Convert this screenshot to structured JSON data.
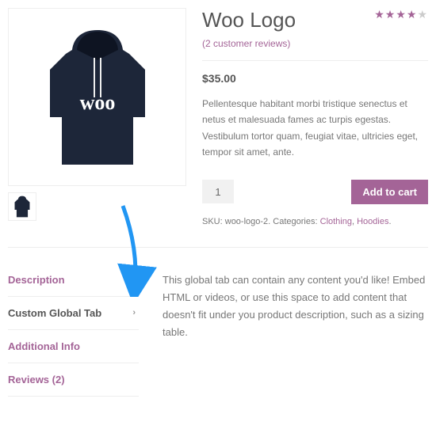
{
  "product": {
    "title": "Woo Logo",
    "reviews_link": "(2 customer reviews)",
    "rating": 4,
    "price": "$35.00",
    "description": "Pellentesque habitant morbi tristique senectus et netus et malesuada fames ac turpis egestas. Vestibulum tortor quam, feugiat vitae, ultricies eget, tempor sit amet, ante.",
    "qty": "1",
    "add_label": "Add to cart",
    "meta": {
      "sku_label": "SKU:",
      "sku": "woo-logo-2",
      "cat_label": "Categories:",
      "cat1": "Clothing",
      "cat_sep": ", ",
      "cat2": "Hoodies",
      "period": "."
    }
  },
  "tabs": {
    "items": [
      {
        "label": "Description"
      },
      {
        "label": "Custom Global Tab"
      },
      {
        "label": "Additional Info"
      },
      {
        "label": "Reviews (2)"
      }
    ],
    "active_chevron": "›",
    "content": "This global tab can contain any content you'd like! Embed HTML or videos, or use this space to add content that doesn't fit under you product description, such as a sizing table."
  }
}
